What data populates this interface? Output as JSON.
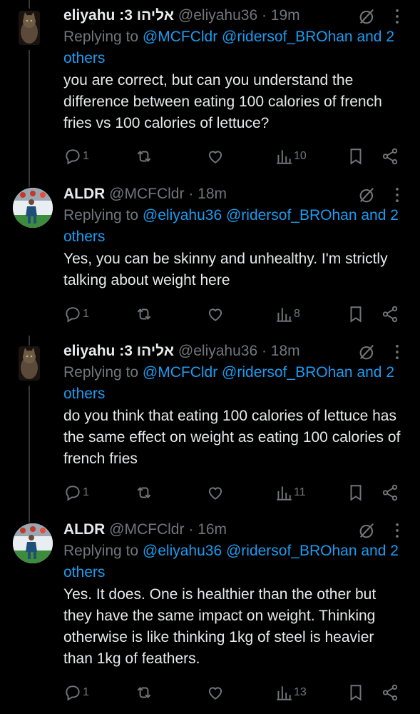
{
  "tweets": [
    {
      "name": "eliyahu :3 אליהו",
      "handle": "@eliyahu36 · 19m",
      "replying_prefix": "Replying to",
      "mentions": "@MCFCldr @ridersof_BROhan and 2 others",
      "text": "you are correct, but can you understand the difference between eating 100 calories of french fries vs 100 calories of lettuce?",
      "replies": "1",
      "views": "10",
      "avatar": "cat-avatar"
    },
    {
      "name": "ALDR",
      "handle": "@MCFCldr · 18m",
      "replying_prefix": "Replying to",
      "mentions": "@eliyahu36 @ridersof_BROhan and 2 others",
      "text": "Yes, you can be skinny and unhealthy. I'm strictly talking about weight here",
      "replies": "1",
      "views": "8",
      "avatar": "football-avatar"
    },
    {
      "name": "eliyahu :3 אליהו",
      "handle": "@eliyahu36 · 18m",
      "replying_prefix": "Replying to",
      "mentions": "@MCFCldr @ridersof_BROhan and 2 others",
      "text": "do you think that eating 100 calories of lettuce has the same effect on weight as eating 100 calories of french fries",
      "replies": "1",
      "views": "11",
      "avatar": "cat-avatar"
    },
    {
      "name": "ALDR",
      "handle": "@MCFCldr · 16m",
      "replying_prefix": "Replying to",
      "mentions": "@eliyahu36 @ridersof_BROhan and 2 others",
      "text": "Yes. It does. One is healthier than the other but they have the same impact on weight. Thinking otherwise is like thinking 1kg of steel is heavier than 1kg of feathers.",
      "replies": "1",
      "views": "13",
      "avatar": "football-avatar"
    }
  ],
  "colors": {
    "background": "#000000",
    "text": "#e7e9ea",
    "muted": "#71767b",
    "link": "#1d9bf0"
  },
  "icons": [
    "reply-icon",
    "retweet-icon",
    "like-icon",
    "views-icon",
    "bookmark-icon",
    "share-icon",
    "grok-icon",
    "more-icon"
  ]
}
